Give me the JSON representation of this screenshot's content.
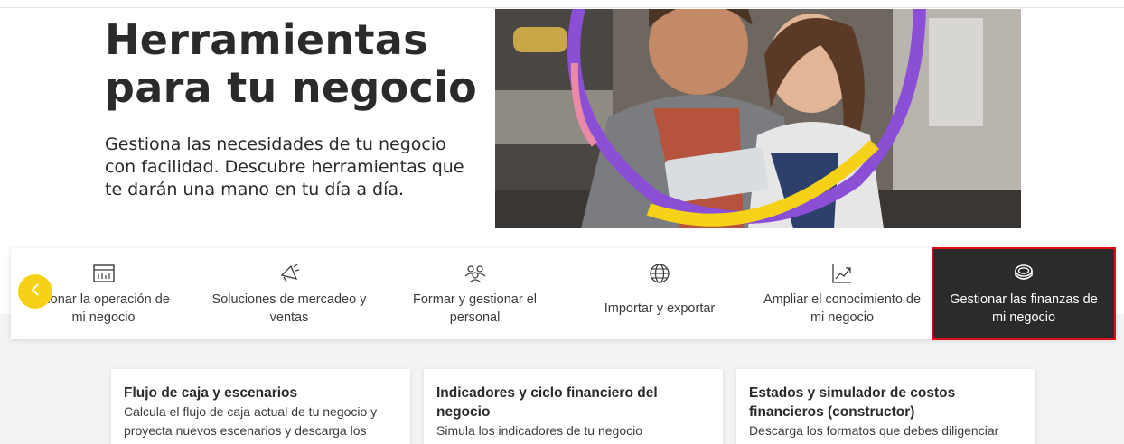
{
  "hero": {
    "title": "Herramientas para tu negocio",
    "description": "Gestiona las necesidades de tu negocio con facilidad. Descubre herramientas que te darán una mano en tu día a día."
  },
  "categories": [
    {
      "label": "stionar la operación de\nmi negocio",
      "icon": "dashboard-icon",
      "active": false
    },
    {
      "label": "Soluciones de mercadeo y\nventas",
      "icon": "megaphone-icon",
      "active": false
    },
    {
      "label": "Formar y gestionar el\npersonal",
      "icon": "people-icon",
      "active": false
    },
    {
      "label": "Importar y exportar",
      "icon": "globe-icon",
      "active": false
    },
    {
      "label": "Ampliar el conocimiento de\nmi negocio",
      "icon": "growth-chart-icon",
      "active": false
    },
    {
      "label": "Gestionar las finanzas de\nmi negocio",
      "icon": "coins-icon",
      "active": true
    }
  ],
  "cards": [
    {
      "title": "Flujo de caja y escenarios",
      "text": "Calcula el flujo de caja actual de tu negocio y proyecta nuevos escenarios y descarga los"
    },
    {
      "title": "Indicadores y ciclo financiero del negocio",
      "text": "Simula los indicadores de tu negocio"
    },
    {
      "title": "Estados y simulador de costos financieros (constructor)",
      "text": "Descarga los formatos que debes diligenciar"
    }
  ],
  "colors": {
    "accent_yellow": "#f5d218",
    "active_bg": "#2b2b2b",
    "active_border": "#e01019",
    "purple_ring": "#8b4fd6"
  },
  "prev_button_icon": "chevron-left-icon"
}
